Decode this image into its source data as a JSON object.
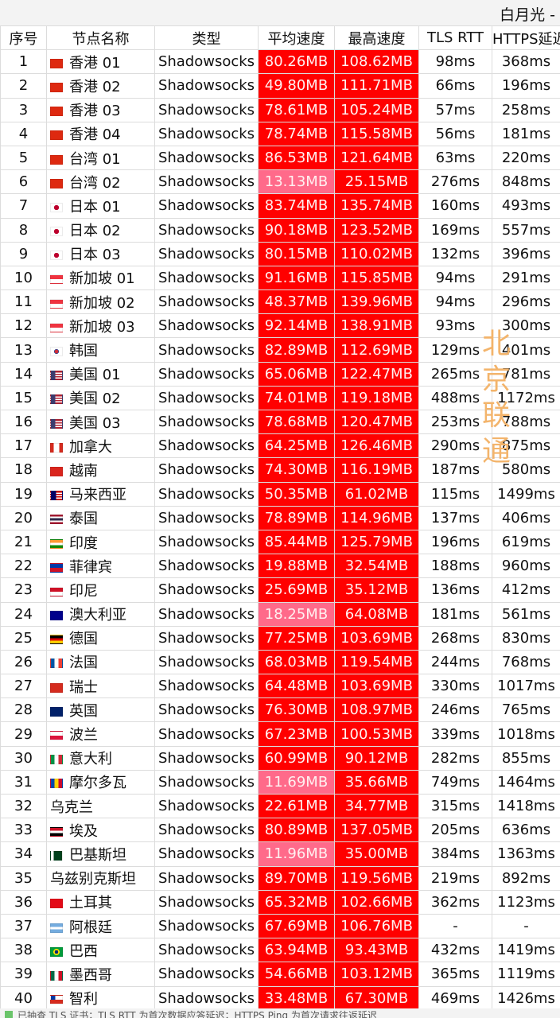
{
  "window": {
    "title": "白月光 -"
  },
  "columns": {
    "index": "序号",
    "name": "节点名称",
    "type": "类型",
    "avg": "平均速度",
    "max": "最高速度",
    "tls": "TLS RTT",
    "https": "HTTPS延迟"
  },
  "overlay": {
    "text": "北京联通"
  },
  "footer": {
    "text": "已抽查 TLS 证书；TLS RTT 为首次数据应答延迟；HTTPS Ping 为首次请求往返延迟"
  },
  "colors": {
    "fast": "#ff0000",
    "slow": "#ff6a8a",
    "overlay": "#f3b46b"
  },
  "rows": [
    {
      "idx": "1",
      "flag": "hk",
      "name": "香港 01",
      "type": "Shadowsocks",
      "avg": "80.26MB",
      "max": "108.62MB",
      "tls": "98ms",
      "https": "368ms",
      "avg_tier": "fast",
      "max_tier": "fast"
    },
    {
      "idx": "2",
      "flag": "hk",
      "name": "香港 02",
      "type": "Shadowsocks",
      "avg": "49.80MB",
      "max": "111.71MB",
      "tls": "66ms",
      "https": "196ms",
      "avg_tier": "fast",
      "max_tier": "fast"
    },
    {
      "idx": "3",
      "flag": "hk",
      "name": "香港 03",
      "type": "Shadowsocks",
      "avg": "78.61MB",
      "max": "105.24MB",
      "tls": "57ms",
      "https": "258ms",
      "avg_tier": "fast",
      "max_tier": "fast"
    },
    {
      "idx": "4",
      "flag": "hk",
      "name": "香港 04",
      "type": "Shadowsocks",
      "avg": "78.74MB",
      "max": "115.58MB",
      "tls": "56ms",
      "https": "181ms",
      "avg_tier": "fast",
      "max_tier": "fast"
    },
    {
      "idx": "5",
      "flag": "cn",
      "name": "台湾 01",
      "type": "Shadowsocks",
      "avg": "86.53MB",
      "max": "121.64MB",
      "tls": "63ms",
      "https": "220ms",
      "avg_tier": "fast",
      "max_tier": "fast"
    },
    {
      "idx": "6",
      "flag": "cn",
      "name": "台湾 02",
      "type": "Shadowsocks",
      "avg": "13.13MB",
      "max": "25.15MB",
      "tls": "276ms",
      "https": "848ms",
      "avg_tier": "slow",
      "max_tier": "fast"
    },
    {
      "idx": "7",
      "flag": "jp",
      "name": "日本 01",
      "type": "Shadowsocks",
      "avg": "83.74MB",
      "max": "135.74MB",
      "tls": "160ms",
      "https": "493ms",
      "avg_tier": "fast",
      "max_tier": "fast"
    },
    {
      "idx": "8",
      "flag": "jp",
      "name": "日本 02",
      "type": "Shadowsocks",
      "avg": "90.18MB",
      "max": "123.52MB",
      "tls": "169ms",
      "https": "557ms",
      "avg_tier": "fast",
      "max_tier": "fast"
    },
    {
      "idx": "9",
      "flag": "jp",
      "name": "日本 03",
      "type": "Shadowsocks",
      "avg": "80.15MB",
      "max": "110.02MB",
      "tls": "132ms",
      "https": "396ms",
      "avg_tier": "fast",
      "max_tier": "fast"
    },
    {
      "idx": "10",
      "flag": "sg",
      "name": "新加坡 01",
      "type": "Shadowsocks",
      "avg": "91.16MB",
      "max": "115.85MB",
      "tls": "94ms",
      "https": "291ms",
      "avg_tier": "fast",
      "max_tier": "fast"
    },
    {
      "idx": "11",
      "flag": "sg",
      "name": "新加坡 02",
      "type": "Shadowsocks",
      "avg": "48.37MB",
      "max": "139.96MB",
      "tls": "94ms",
      "https": "296ms",
      "avg_tier": "fast",
      "max_tier": "fast"
    },
    {
      "idx": "12",
      "flag": "sg",
      "name": "新加坡 03",
      "type": "Shadowsocks",
      "avg": "92.14MB",
      "max": "138.91MB",
      "tls": "93ms",
      "https": "300ms",
      "avg_tier": "fast",
      "max_tier": "fast"
    },
    {
      "idx": "13",
      "flag": "kr",
      "name": "韩国",
      "type": "Shadowsocks",
      "avg": "82.89MB",
      "max": "112.69MB",
      "tls": "129ms",
      "https": "401ms",
      "avg_tier": "fast",
      "max_tier": "fast"
    },
    {
      "idx": "14",
      "flag": "us",
      "name": "美国 01",
      "type": "Shadowsocks",
      "avg": "65.06MB",
      "max": "122.47MB",
      "tls": "265ms",
      "https": "781ms",
      "avg_tier": "fast",
      "max_tier": "fast"
    },
    {
      "idx": "15",
      "flag": "us",
      "name": "美国 02",
      "type": "Shadowsocks",
      "avg": "74.01MB",
      "max": "119.18MB",
      "tls": "488ms",
      "https": "1172ms",
      "avg_tier": "fast",
      "max_tier": "fast"
    },
    {
      "idx": "16",
      "flag": "us",
      "name": "美国 03",
      "type": "Shadowsocks",
      "avg": "78.68MB",
      "max": "120.47MB",
      "tls": "253ms",
      "https": "788ms",
      "avg_tier": "fast",
      "max_tier": "fast"
    },
    {
      "idx": "17",
      "flag": "ca",
      "name": "加拿大",
      "type": "Shadowsocks",
      "avg": "64.25MB",
      "max": "126.46MB",
      "tls": "290ms",
      "https": "875ms",
      "avg_tier": "fast",
      "max_tier": "fast"
    },
    {
      "idx": "18",
      "flag": "vn",
      "name": "越南",
      "type": "Shadowsocks",
      "avg": "74.30MB",
      "max": "116.19MB",
      "tls": "187ms",
      "https": "580ms",
      "avg_tier": "fast",
      "max_tier": "fast"
    },
    {
      "idx": "19",
      "flag": "my",
      "name": "马来西亚",
      "type": "Shadowsocks",
      "avg": "50.35MB",
      "max": "61.02MB",
      "tls": "115ms",
      "https": "1499ms",
      "avg_tier": "fast",
      "max_tier": "fast"
    },
    {
      "idx": "20",
      "flag": "th",
      "name": "泰国",
      "type": "Shadowsocks",
      "avg": "78.89MB",
      "max": "114.96MB",
      "tls": "137ms",
      "https": "406ms",
      "avg_tier": "fast",
      "max_tier": "fast"
    },
    {
      "idx": "21",
      "flag": "in",
      "name": "印度",
      "type": "Shadowsocks",
      "avg": "85.44MB",
      "max": "125.79MB",
      "tls": "196ms",
      "https": "619ms",
      "avg_tier": "fast",
      "max_tier": "fast"
    },
    {
      "idx": "22",
      "flag": "ph",
      "name": "菲律宾",
      "type": "Shadowsocks",
      "avg": "19.88MB",
      "max": "32.54MB",
      "tls": "188ms",
      "https": "960ms",
      "avg_tier": "fast",
      "max_tier": "fast"
    },
    {
      "idx": "23",
      "flag": "id",
      "name": "印尼",
      "type": "Shadowsocks",
      "avg": "25.69MB",
      "max": "35.12MB",
      "tls": "136ms",
      "https": "412ms",
      "avg_tier": "fast",
      "max_tier": "fast"
    },
    {
      "idx": "24",
      "flag": "au",
      "name": "澳大利亚",
      "type": "Shadowsocks",
      "avg": "18.25MB",
      "max": "64.08MB",
      "tls": "181ms",
      "https": "561ms",
      "avg_tier": "slow",
      "max_tier": "fast"
    },
    {
      "idx": "25",
      "flag": "de",
      "name": "德国",
      "type": "Shadowsocks",
      "avg": "77.25MB",
      "max": "103.69MB",
      "tls": "268ms",
      "https": "830ms",
      "avg_tier": "fast",
      "max_tier": "fast"
    },
    {
      "idx": "26",
      "flag": "fr",
      "name": "法国",
      "type": "Shadowsocks",
      "avg": "68.03MB",
      "max": "119.54MB",
      "tls": "244ms",
      "https": "768ms",
      "avg_tier": "fast",
      "max_tier": "fast"
    },
    {
      "idx": "27",
      "flag": "ch",
      "name": "瑞士",
      "type": "Shadowsocks",
      "avg": "64.48MB",
      "max": "103.69MB",
      "tls": "330ms",
      "https": "1017ms",
      "avg_tier": "fast",
      "max_tier": "fast"
    },
    {
      "idx": "28",
      "flag": "gb",
      "name": "英国",
      "type": "Shadowsocks",
      "avg": "76.30MB",
      "max": "108.97MB",
      "tls": "246ms",
      "https": "765ms",
      "avg_tier": "fast",
      "max_tier": "fast"
    },
    {
      "idx": "29",
      "flag": "pl",
      "name": "波兰",
      "type": "Shadowsocks",
      "avg": "67.23MB",
      "max": "100.53MB",
      "tls": "339ms",
      "https": "1018ms",
      "avg_tier": "fast",
      "max_tier": "fast"
    },
    {
      "idx": "30",
      "flag": "it",
      "name": "意大利",
      "type": "Shadowsocks",
      "avg": "60.99MB",
      "max": "90.12MB",
      "tls": "282ms",
      "https": "855ms",
      "avg_tier": "fast",
      "max_tier": "fast"
    },
    {
      "idx": "31",
      "flag": "md",
      "name": "摩尔多瓦",
      "type": "Shadowsocks",
      "avg": "11.69MB",
      "max": "35.66MB",
      "tls": "749ms",
      "https": "1464ms",
      "avg_tier": "slow",
      "max_tier": "fast"
    },
    {
      "idx": "32",
      "flag": "",
      "name": "乌克兰",
      "type": "Shadowsocks",
      "avg": "22.61MB",
      "max": "34.77MB",
      "tls": "315ms",
      "https": "1418ms",
      "avg_tier": "fast",
      "max_tier": "fast"
    },
    {
      "idx": "33",
      "flag": "eg",
      "name": "埃及",
      "type": "Shadowsocks",
      "avg": "80.89MB",
      "max": "137.05MB",
      "tls": "205ms",
      "https": "636ms",
      "avg_tier": "fast",
      "max_tier": "fast"
    },
    {
      "idx": "34",
      "flag": "pk",
      "name": "巴基斯坦",
      "type": "Shadowsocks",
      "avg": "11.96MB",
      "max": "35.00MB",
      "tls": "384ms",
      "https": "1363ms",
      "avg_tier": "slow",
      "max_tier": "fast"
    },
    {
      "idx": "35",
      "flag": "",
      "name": "乌兹别克斯坦",
      "type": "Shadowsocks",
      "avg": "89.70MB",
      "max": "119.56MB",
      "tls": "219ms",
      "https": "892ms",
      "avg_tier": "fast",
      "max_tier": "fast"
    },
    {
      "idx": "36",
      "flag": "tr",
      "name": "土耳其",
      "type": "Shadowsocks",
      "avg": "65.32MB",
      "max": "102.66MB",
      "tls": "362ms",
      "https": "1123ms",
      "avg_tier": "fast",
      "max_tier": "fast"
    },
    {
      "idx": "37",
      "flag": "ar",
      "name": "阿根廷",
      "type": "Shadowsocks",
      "avg": "67.69MB",
      "max": "106.76MB",
      "tls": "-",
      "https": "-",
      "avg_tier": "fast",
      "max_tier": "fast"
    },
    {
      "idx": "38",
      "flag": "br",
      "name": "巴西",
      "type": "Shadowsocks",
      "avg": "63.94MB",
      "max": "93.43MB",
      "tls": "432ms",
      "https": "1419ms",
      "avg_tier": "fast",
      "max_tier": "fast"
    },
    {
      "idx": "39",
      "flag": "mx",
      "name": "墨西哥",
      "type": "Shadowsocks",
      "avg": "54.66MB",
      "max": "103.12MB",
      "tls": "365ms",
      "https": "1119ms",
      "avg_tier": "fast",
      "max_tier": "fast"
    },
    {
      "idx": "40",
      "flag": "cl",
      "name": "智利",
      "type": "Shadowsocks",
      "avg": "33.48MB",
      "max": "67.30MB",
      "tls": "469ms",
      "https": "1426ms",
      "avg_tier": "fast",
      "max_tier": "fast"
    }
  ],
  "flags": {
    "hk": {
      "icon": "hong-kong-flag-icon",
      "bg": "#de2910"
    },
    "cn": {
      "icon": "china-flag-icon",
      "bg": "#de2910"
    },
    "jp": {
      "icon": "japan-flag-icon",
      "bg": "radial-gradient(circle,#bc002d 35%,#ffffff 38%)"
    },
    "sg": {
      "icon": "singapore-flag-icon",
      "bg": "linear-gradient(#ef3340 50%,#ffffff 50%)"
    },
    "kr": {
      "icon": "korea-flag-icon",
      "bg": "radial-gradient(circle,#cd2e3a 28%,#0047a0 30%,#0047a0 34%,#ffffff 36%)"
    },
    "us": {
      "icon": "usa-flag-icon",
      "bg": "linear-gradient(90deg,#3c3b6e 40%,transparent 40%),repeating-linear-gradient(#b22234 0 1.5px,#ffffff 1.5px 3px)"
    },
    "ca": {
      "icon": "canada-flag-icon",
      "bg": "linear-gradient(90deg,#d52b1e 25%,#ffffff 25%,#ffffff 75%,#d52b1e 75%)"
    },
    "vn": {
      "icon": "vietnam-flag-icon",
      "bg": "#da251d"
    },
    "my": {
      "icon": "malaysia-flag-icon",
      "bg": "linear-gradient(90deg,#010066 45%,transparent 45%),repeating-linear-gradient(#cc0001 0 1.5px,#ffffff 1.5px 3px)"
    },
    "th": {
      "icon": "thailand-flag-icon",
      "bg": "linear-gradient(#a51931 17%,#ffffff 17%,#ffffff 33%,#2d2a4a 33%,#2d2a4a 67%,#ffffff 67%,#ffffff 83%,#a51931 83%)"
    },
    "in": {
      "icon": "india-flag-icon",
      "bg": "linear-gradient(#ff9933 33%,#ffffff 33%,#ffffff 67%,#138808 67%)"
    },
    "ph": {
      "icon": "philippines-flag-icon",
      "bg": "linear-gradient(#0038a8 50%,#ce1126 50%)"
    },
    "id": {
      "icon": "indonesia-flag-icon",
      "bg": "linear-gradient(#ce1126 50%,#ffffff 50%)"
    },
    "au": {
      "icon": "australia-flag-icon",
      "bg": "#00008b"
    },
    "de": {
      "icon": "germany-flag-icon",
      "bg": "linear-gradient(#000000 33%,#dd0000 33%,#dd0000 67%,#ffce00 67%)"
    },
    "fr": {
      "icon": "france-flag-icon",
      "bg": "linear-gradient(90deg,#0055a4 33%,#ffffff 33%,#ffffff 67%,#ef4135 67%)"
    },
    "ch": {
      "icon": "switzerland-flag-icon",
      "bg": "#d52b1e"
    },
    "gb": {
      "icon": "uk-flag-icon",
      "bg": "#012169"
    },
    "pl": {
      "icon": "poland-flag-icon",
      "bg": "linear-gradient(#ffffff 50%,#dc143c 50%)"
    },
    "it": {
      "icon": "italy-flag-icon",
      "bg": "linear-gradient(90deg,#009246 33%,#ffffff 33%,#ffffff 67%,#ce2b37 67%)"
    },
    "md": {
      "icon": "moldova-flag-icon",
      "bg": "linear-gradient(90deg,#0046ae 33%,#ffd200 33%,#ffd200 67%,#cc092f 67%)"
    },
    "eg": {
      "icon": "egypt-flag-icon",
      "bg": "linear-gradient(#ce1126 33%,#ffffff 33%,#ffffff 67%,#000000 67%)"
    },
    "pk": {
      "icon": "pakistan-flag-icon",
      "bg": "linear-gradient(90deg,#ffffff 25%,#01411c 25%)"
    },
    "tr": {
      "icon": "turkey-flag-icon",
      "bg": "#e30a17"
    },
    "ar": {
      "icon": "argentina-flag-icon",
      "bg": "linear-gradient(#74acdf 33%,#ffffff 33%,#ffffff 67%,#74acdf 67%)"
    },
    "br": {
      "icon": "brazil-flag-icon",
      "bg": "radial-gradient(circle,#002776 25%,#ffdf00 27%,#ffdf00 45%,#009c3b 47%)"
    },
    "mx": {
      "icon": "mexico-flag-icon",
      "bg": "linear-gradient(90deg,#006847 33%,#ffffff 33%,#ffffff 67%,#ce1126 67%)"
    },
    "cl": {
      "icon": "chile-flag-icon",
      "bg": "linear-gradient(90deg,#0039a6 40%,transparent 40%) top/100% 50% no-repeat,linear-gradient(#ffffff 50%,#d52b1e 50%)"
    }
  }
}
